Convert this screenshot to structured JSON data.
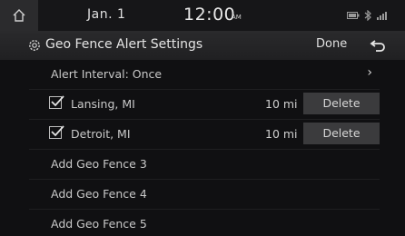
{
  "status": {
    "date": "Jan.  1",
    "time": "12:00",
    "ampm": "AM"
  },
  "header": {
    "title": "Geo Fence Alert Settings",
    "done_label": "Done"
  },
  "alert_interval": {
    "label": "Alert Interval: Once"
  },
  "fences": [
    {
      "name": "Lansing, MI",
      "distance": "10 mi",
      "delete_label": "Delete",
      "checked": true
    },
    {
      "name": "Detroit, MI",
      "distance": "10 mi",
      "delete_label": "Delete",
      "checked": true
    }
  ],
  "add_items": [
    "Add Geo Fence 3",
    "Add Geo Fence 4",
    "Add Geo Fence 5"
  ],
  "icons": {
    "home": "home-icon",
    "gear": "gear-icon",
    "back": "back-arrow-icon",
    "checkbox": "checkbox-checked-icon"
  },
  "colors": {
    "background": "#101012",
    "button": "#3b3b3d",
    "header": "#2a2a2c"
  }
}
